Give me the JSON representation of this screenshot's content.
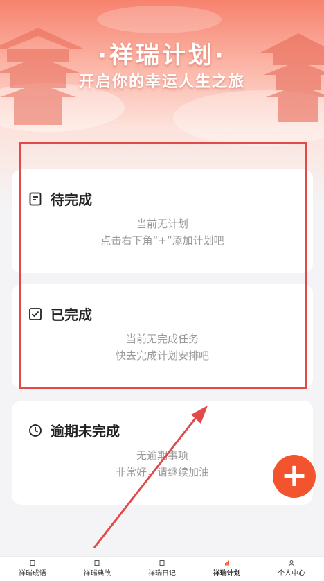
{
  "header": {
    "title": "·祥瑞计划·",
    "subtitle": "开启你的幸运人生之旅"
  },
  "sections": {
    "pending": {
      "title": "待完成",
      "icon": "document-icon",
      "message_line1": "当前无计划",
      "message_line2": "点击右下角“+”添加计划吧"
    },
    "done": {
      "title": "已完成",
      "icon": "checkbox-icon",
      "message_line1": "当前无完成任务",
      "message_line2": "快去完成计划安排吧"
    },
    "overdue": {
      "title": "逾期未完成",
      "icon": "clock-icon",
      "message_line1": "无逾期事项",
      "message_line2": "非常好，请继续加油"
    }
  },
  "fab": {
    "label": "+"
  },
  "tabs": [
    {
      "label": "祥瑞成语",
      "active": false
    },
    {
      "label": "祥瑞典故",
      "active": false
    },
    {
      "label": "祥瑞日记",
      "active": false
    },
    {
      "label": "祥瑞计划",
      "active": true
    },
    {
      "label": "个人中心",
      "active": false
    }
  ],
  "colors": {
    "accent": "#f2542d",
    "annotation": "#e24a4a",
    "card_bg": "#ffffff",
    "muted_text": "#9a9a9a"
  }
}
